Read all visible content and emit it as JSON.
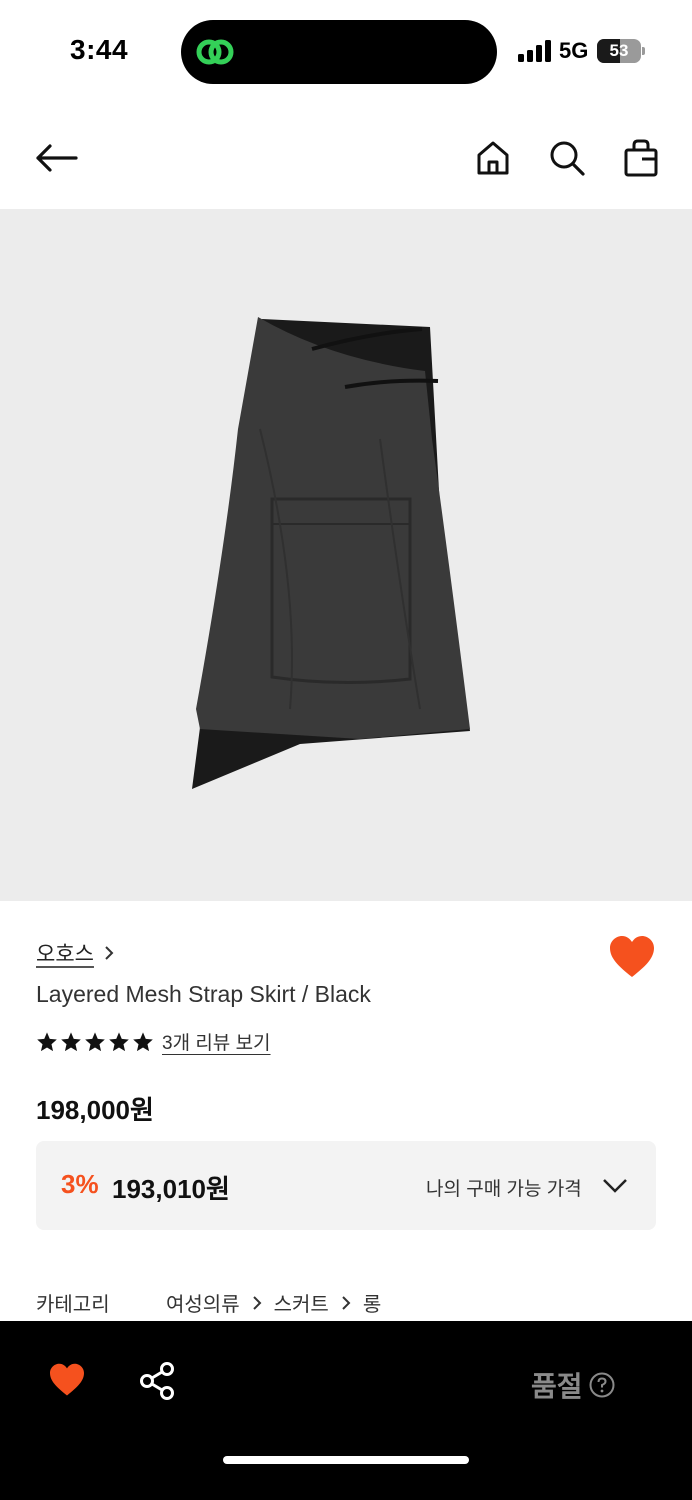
{
  "status_bar": {
    "time": "3:44",
    "network": "5G",
    "battery_level": "53",
    "battery_fraction": 0.53,
    "island_icon": "link-chain-icon",
    "island_icon_color": "#34d058"
  },
  "nav": {
    "back_icon": "back-arrow-icon",
    "home_icon": "home-icon",
    "search_icon": "search-icon",
    "cart_icon": "shopping-bag-icon"
  },
  "product": {
    "image_subject": "black-layered-skirt",
    "brand": "오호스",
    "name": "Layered Mesh Strap Skirt / Black",
    "rating_stars": 5,
    "review_link": "3개 리뷰 보기",
    "price": "198,000원",
    "discount_rate": "3%",
    "discounted_price": "193,010원",
    "my_price_label": "나의 구매 가능 가격",
    "wishlisted": true
  },
  "category": {
    "label": "카테고리",
    "path": [
      "여성의류",
      "스커트",
      "롱"
    ]
  },
  "bottom_bar": {
    "like_icon": "heart-icon",
    "share_icon": "share-icon",
    "soldout_label": "품절",
    "help_icon": "question-circle-icon"
  },
  "colors": {
    "accent": "#f5511e",
    "image_background": "#ececec",
    "price_box_background": "#f3f3f3",
    "bottom_bar_background": "#000000",
    "soldout_text": "#8a8a8a"
  }
}
